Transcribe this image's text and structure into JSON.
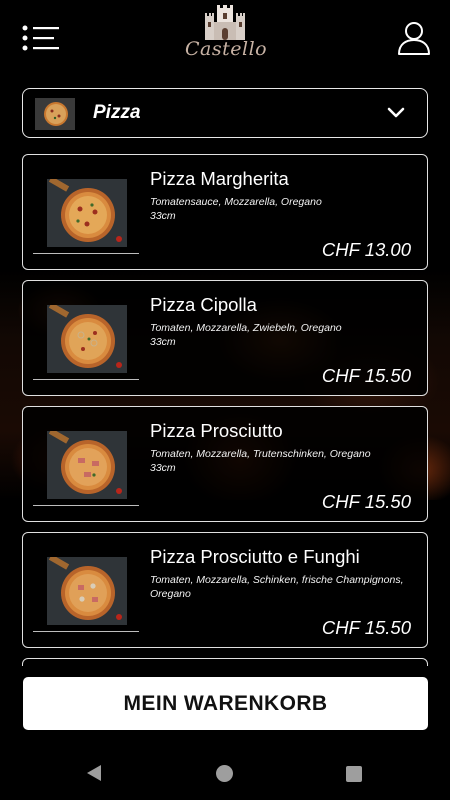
{
  "app": {
    "logo_text": "Castello"
  },
  "category": {
    "selected": "Pizza"
  },
  "products": [
    {
      "name": "Pizza Margherita",
      "description": "Tomatensauce, Mozzarella, Oregano",
      "size": "33cm",
      "price": "CHF 13.00"
    },
    {
      "name": "Pizza Cipolla",
      "description": "Tomaten, Mozzarella, Zwiebeln, Oregano",
      "size": "33cm",
      "price": "CHF 15.50"
    },
    {
      "name": "Pizza Prosciutto",
      "description": "Tomaten, Mozzarella, Trutenschinken, Oregano",
      "size": "33cm",
      "price": "CHF 15.50"
    },
    {
      "name": "Pizza Prosciutto e Funghi",
      "description": "Tomaten, Mozzarella, Schinken, frische Champignons, Oregano",
      "size": "",
      "price": "CHF 15.50"
    }
  ],
  "cart": {
    "button_label": "MEIN WARENKORB"
  },
  "icons": {
    "menu": "menu-list-icon",
    "user": "user-icon",
    "dropdown": "chevron-down-icon",
    "nav_back": "back-triangle-icon",
    "nav_home": "home-circle-icon",
    "nav_recent": "recent-square-icon"
  },
  "colors": {
    "background": "#000000",
    "text": "#ffffff",
    "logo": "#c7b2a4",
    "card_border": "#e0e0e0",
    "button": "#ffffff"
  }
}
